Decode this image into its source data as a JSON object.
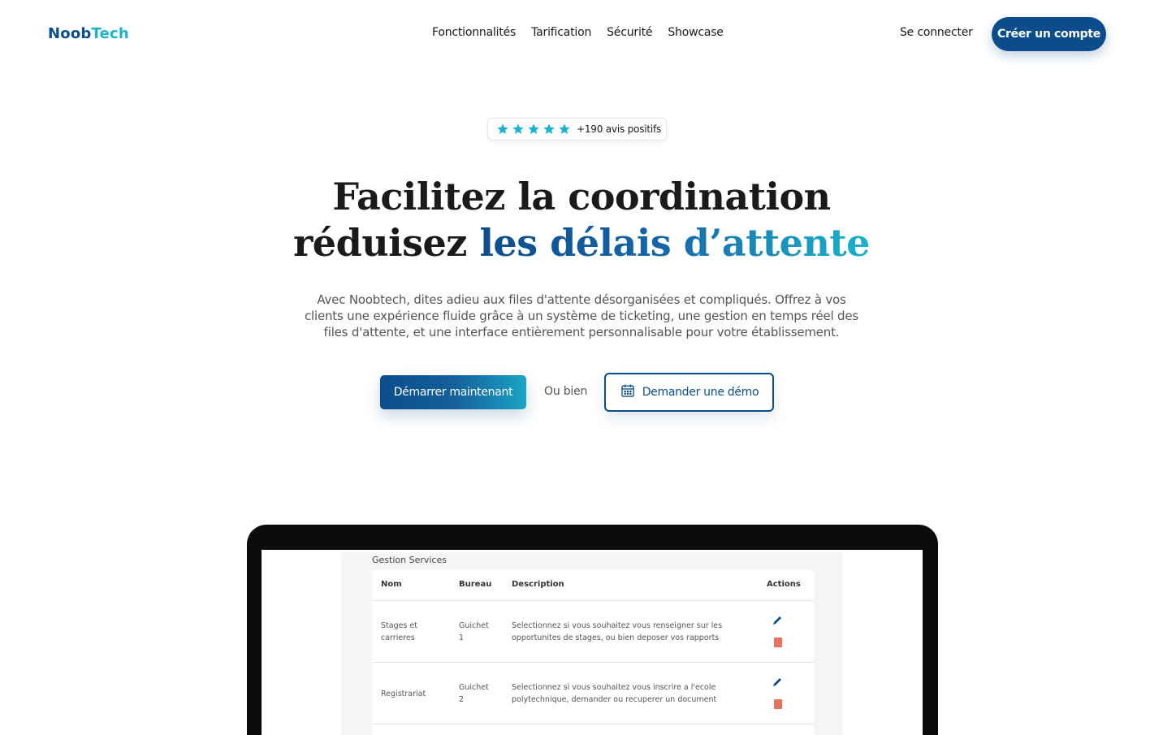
{
  "nav": {
    "logo_part1": "Noob",
    "logo_part2": "Tech",
    "menu": [
      "Fonctionnalités",
      "Tarification",
      "Sécurité",
      "Showcase"
    ],
    "login": "Se connecter",
    "signup": "Créer un compte"
  },
  "rating": {
    "stars": 5,
    "text": "+190 avis positifs"
  },
  "hero": {
    "line1": "Facilitez la coordination",
    "line2_plain": "réduisez ",
    "line2_highlight": "les délais d’attente",
    "description": "Avec Noobtech, dites adieu aux files d'attente désorganisées et compliqués. Offrez à vos clients une expérience fluide grâce à un système de ticketing, une gestion en temps réel des files d'attente, et une interface entièrement personnalisable pour votre établissement.",
    "cta_primary": "Démarrer maintenant",
    "or": "Ou bien",
    "cta_secondary": "Demander une démo"
  },
  "preview": {
    "title": "Gestion Services",
    "columns": [
      "Nom",
      "Bureau",
      "Description",
      "Actions"
    ],
    "rows": [
      {
        "name": "Stages et\ncarrieres",
        "bureau": "Guichet\n1",
        "description": "Selectionnez si vous souhaitez vous renseigner sur les\nopportunites de stages, ou bien deposer vos rapports"
      },
      {
        "name": "Registrariat",
        "bureau": "Guichet\n2",
        "description": "Selectionnez si vous souhaitez vous inscrire a l'ecole\npolytechnique, demander ou recuperer un document"
      }
    ]
  },
  "colors": {
    "primary": "#0b4d8c",
    "accent": "#1bb3cc",
    "star": "#1bb3cc",
    "delete": "#e8705e"
  }
}
